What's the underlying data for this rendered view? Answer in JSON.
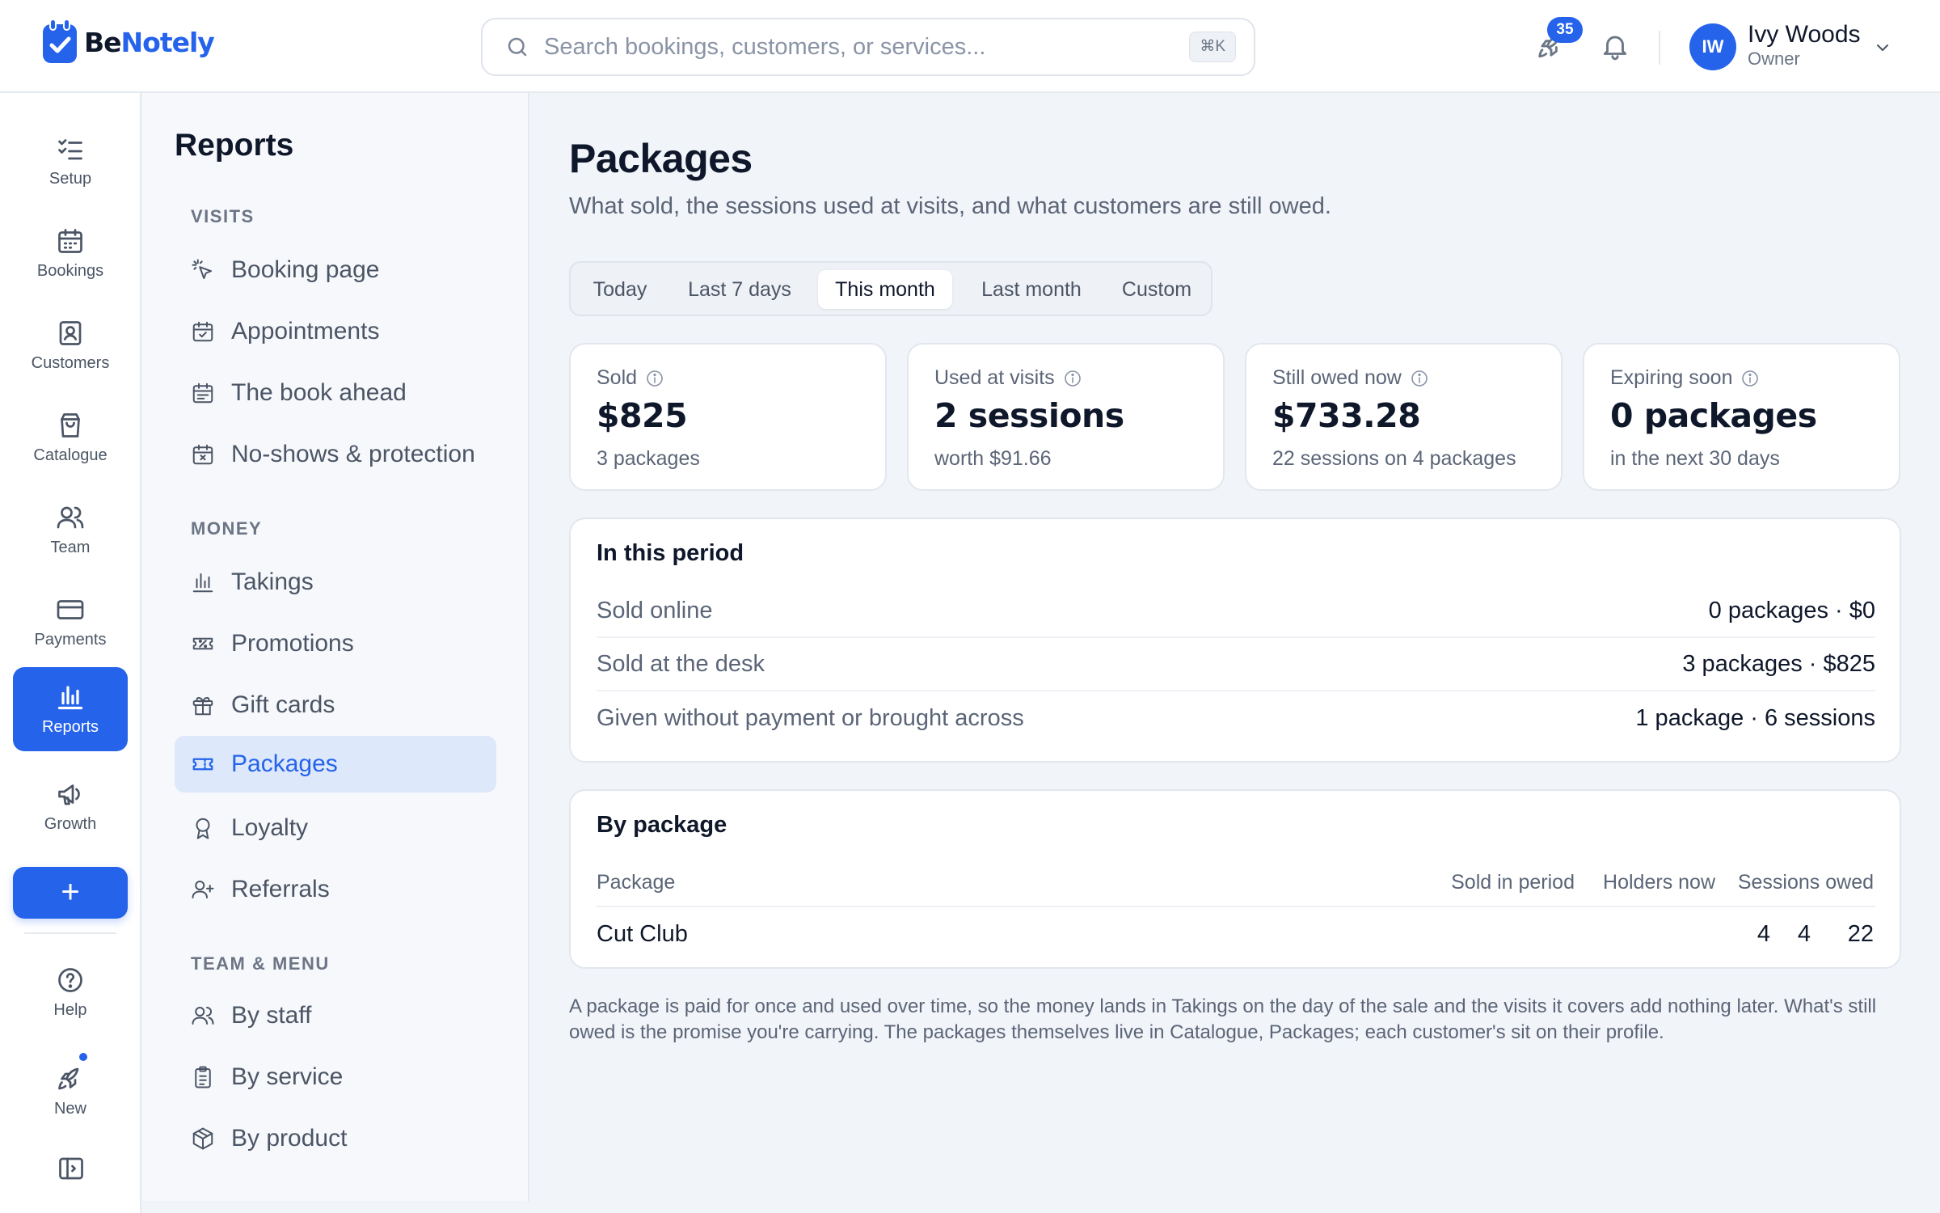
{
  "brand": {
    "be": "Be",
    "notely": "Notely"
  },
  "search": {
    "placeholder": "Search bookings, customers, or services...",
    "shortcut": "⌘K"
  },
  "header": {
    "notifications_count": "35"
  },
  "user": {
    "initials": "IW",
    "name": "Ivy Woods",
    "role": "Owner"
  },
  "rail": {
    "items": [
      {
        "label": "Setup",
        "icon": "checklist-icon"
      },
      {
        "label": "Bookings",
        "icon": "calendar-icon"
      },
      {
        "label": "Customers",
        "icon": "contact-card-icon"
      },
      {
        "label": "Catalogue",
        "icon": "shopping-bag-icon"
      },
      {
        "label": "Team",
        "icon": "users-icon"
      },
      {
        "label": "Payments",
        "icon": "credit-card-icon"
      },
      {
        "label": "Reports",
        "icon": "bar-chart-icon",
        "active": true
      },
      {
        "label": "Growth",
        "icon": "megaphone-icon"
      }
    ],
    "add_label": "+",
    "help_label": "Help",
    "new_label": "New"
  },
  "sidebar": {
    "title": "Reports",
    "sections": [
      {
        "title": "VISITS",
        "items": [
          {
            "label": "Booking page",
            "icon": "pointer-click-icon"
          },
          {
            "label": "Appointments",
            "icon": "calendar-check-icon"
          },
          {
            "label": "The book ahead",
            "icon": "calendar-days-icon"
          },
          {
            "label": "No-shows & protection",
            "icon": "calendar-x-icon"
          }
        ]
      },
      {
        "title": "MONEY",
        "items": [
          {
            "label": "Takings",
            "icon": "bar-chart-icon"
          },
          {
            "label": "Promotions",
            "icon": "ticket-percent-icon"
          },
          {
            "label": "Gift cards",
            "icon": "gift-icon"
          },
          {
            "label": "Packages",
            "icon": "ticket-icon",
            "active": true
          },
          {
            "label": "Loyalty",
            "icon": "award-icon"
          },
          {
            "label": "Referrals",
            "icon": "user-plus-icon"
          }
        ]
      },
      {
        "title": "TEAM & MENU",
        "items": [
          {
            "label": "By staff",
            "icon": "users-icon"
          },
          {
            "label": "By service",
            "icon": "clipboard-list-icon"
          },
          {
            "label": "By product",
            "icon": "package-icon"
          }
        ]
      }
    ]
  },
  "page": {
    "title": "Packages",
    "subtitle": "What sold, the sessions used at visits, and what customers are still owed."
  },
  "tabs": [
    {
      "label": "Today"
    },
    {
      "label": "Last 7 days"
    },
    {
      "label": "This month",
      "active": true
    },
    {
      "label": "Last month"
    },
    {
      "label": "Custom"
    }
  ],
  "stats": [
    {
      "label": "Sold",
      "value": "$825",
      "sub": "3 packages"
    },
    {
      "label": "Used at visits",
      "value": "2 sessions",
      "sub": "worth $91.66"
    },
    {
      "label": "Still owed now",
      "value": "$733.28",
      "sub": "22 sessions on 4 packages"
    },
    {
      "label": "Expiring soon",
      "value": "0 packages",
      "sub": "in the next 30 days"
    }
  ],
  "period": {
    "title": "In this period",
    "rows": [
      {
        "label": "Sold online",
        "value": "0 packages · $0"
      },
      {
        "label": "Sold at the desk",
        "value": "3 packages · $825"
      },
      {
        "label": "Given without payment or brought across",
        "value": "1 package · 6 sessions"
      }
    ]
  },
  "by_package": {
    "title": "By package",
    "columns": [
      "Package",
      "Sold in period",
      "Holders now",
      "Sessions owed"
    ],
    "rows": [
      {
        "package": "Cut Club",
        "sold": "4",
        "holders": "4",
        "owed": "22"
      }
    ]
  },
  "footnote": "A package is paid for once and used over time, so the money lands in Takings on the day of the sale and the visits it covers add nothing later. What's still owed is the promise you're carrying. The packages themselves live in Catalogue, Packages; each customer's sit on their profile.",
  "colors": {
    "accent": "#2563eb",
    "text": "#0f172a",
    "muted": "#5b6577",
    "background": "#f1f4f9"
  }
}
